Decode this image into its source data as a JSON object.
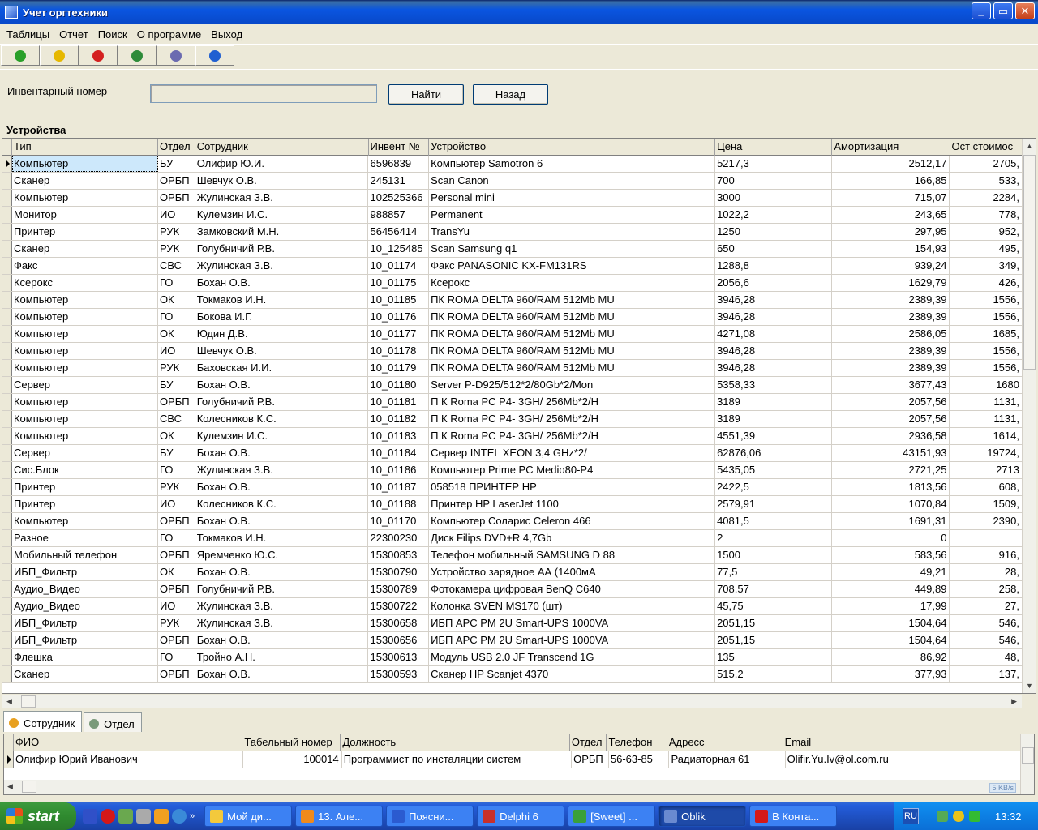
{
  "window": {
    "title": "Учет оргтехники"
  },
  "menu": [
    "Таблицы",
    "Отчет",
    "Поиск",
    "О программе",
    "Выход"
  ],
  "toolbar_icons": [
    {
      "name": "ok-icon",
      "color": "#2aa02a"
    },
    {
      "name": "edit-pencil-icon",
      "color": "#e6b800"
    },
    {
      "name": "delete-icon",
      "color": "#d42020"
    },
    {
      "name": "excel-export-icon",
      "color": "#2e8b3a"
    },
    {
      "name": "tools-icon",
      "color": "#6b6bb0"
    },
    {
      "name": "info-icon",
      "color": "#1f5fd1"
    }
  ],
  "search": {
    "label": "Инвентарный номер",
    "value": "",
    "find_label": "Найти",
    "back_label": "Назад"
  },
  "devices": {
    "title": "Устройства",
    "columns": [
      "Тип",
      "Отдел",
      "Сотрудник",
      "Инвент №",
      "Устройство",
      "Цена",
      "Амортизация",
      "Ост стоимос"
    ],
    "rows": [
      [
        "Компьютер",
        "БУ",
        "Олифир Ю.И.",
        "6596839",
        "Компьютер Samotron 6",
        "5217,3",
        "2512,17",
        "2705,"
      ],
      [
        "Сканер",
        "ОРБП",
        "Шевчук О.В.",
        "245131",
        "Scan Canon",
        "700",
        "166,85",
        "533,"
      ],
      [
        "Компьютер",
        "ОРБП",
        "Жулинская З.В.",
        "102525366",
        "Personal mini",
        "3000",
        "715,07",
        "2284,"
      ],
      [
        "Монитор",
        "ИО",
        "Кулемзин И.С.",
        "988857",
        "Permanent",
        "1022,2",
        "243,65",
        "778,"
      ],
      [
        "Принтер",
        "РУК",
        "Замковский М.Н.",
        "56456414",
        "TransYu",
        "1250",
        "297,95",
        "952,"
      ],
      [
        "Сканер",
        "РУК",
        "Голубничий Р.В.",
        "10_125485",
        "Scan Samsung q1",
        "650",
        "154,93",
        "495,"
      ],
      [
        "Факс",
        "СВС",
        "Жулинская З.В.",
        "10_01174",
        "Факс PANASONIC KX-FM131RS",
        "1288,8",
        "939,24",
        "349,"
      ],
      [
        "Ксерокс",
        "ГО",
        "Бохан О.В.",
        "10_01175",
        "Ксерокс",
        "2056,6",
        "1629,79",
        "426,"
      ],
      [
        "Компьютер",
        "ОК",
        "Токмаков И.Н.",
        "10_01185",
        "ПК ROMA DELTA 960/RAM 512Mb MU",
        "3946,28",
        "2389,39",
        "1556,"
      ],
      [
        "Компьютер",
        "ГО",
        "Бокова И.Г.",
        "10_01176",
        "ПК ROMA DELTA 960/RAM 512Mb MU",
        "3946,28",
        "2389,39",
        "1556,"
      ],
      [
        "Компьютер",
        "ОК",
        "Юдин Д.В.",
        "10_01177",
        "ПК ROMA DELTA 960/RAM 512Mb MU",
        "4271,08",
        "2586,05",
        "1685,"
      ],
      [
        "Компьютер",
        "ИО",
        "Шевчук О.В.",
        "10_01178",
        "ПК ROMA DELTA 960/RAM 512Mb MU",
        "3946,28",
        "2389,39",
        "1556,"
      ],
      [
        "Компьютер",
        "РУК",
        "Баховская И.И.",
        "10_01179",
        "ПК ROMA DELTA 960/RAM 512Mb MU",
        "3946,28",
        "2389,39",
        "1556,"
      ],
      [
        "Сервер",
        "БУ",
        "Бохан О.В.",
        "10_01180",
        "Server P-D925/512*2/80Gb*2/Mon",
        "5358,33",
        "3677,43",
        "1680"
      ],
      [
        "Компьютер",
        "ОРБП",
        "Голубничий Р.В.",
        "10_01181",
        "П К Roma PC P4- 3GH/ 256Mb*2/H",
        "3189",
        "2057,56",
        "1131,"
      ],
      [
        "Компьютер",
        "СВС",
        "Колесников К.С.",
        "10_01182",
        "П К Roma PC P4- 3GH/ 256Mb*2/H",
        "3189",
        "2057,56",
        "1131,"
      ],
      [
        "Компьютер",
        "ОК",
        "Кулемзин И.С.",
        "10_01183",
        "П К Roma PC P4- 3GH/ 256Mb*2/H",
        "4551,39",
        "2936,58",
        "1614,"
      ],
      [
        "Сервер",
        "БУ",
        "Бохан О.В.",
        "10_01184",
        "Сервер  INTEL XEON 3,4 GHz*2/",
        "62876,06",
        "43151,93",
        "19724,"
      ],
      [
        "Сис.Блок",
        "ГО",
        "Жулинская З.В.",
        "10_01186",
        "Компьютер Prime PC Medio80-P4",
        "5435,05",
        "2721,25",
        "2713"
      ],
      [
        "Принтер",
        "РУК",
        "Бохан О.В.",
        "10_01187",
        "058518 ПРИНТЕР HP",
        "2422,5",
        "1813,56",
        "608,"
      ],
      [
        "Принтер",
        "ИО",
        "Колесников К.С.",
        "10_01188",
        "Принтер HP LaserJet 1100",
        "2579,91",
        "1070,84",
        "1509,"
      ],
      [
        "Компьютер",
        "ОРБП",
        "Бохан О.В.",
        "10_01170",
        "Компьютер Соларис Celeron 466",
        "4081,5",
        "1691,31",
        "2390,"
      ],
      [
        "Разное",
        "ГО",
        "Токмаков И.Н.",
        "22300230",
        "Диск Filips DVD+R 4,7Gb",
        "2",
        "0",
        ""
      ],
      [
        "Мобильный телефон",
        "ОРБП",
        "Яремченко Ю.С.",
        "15300853",
        "Телефон мобильный SAMSUNG D 88",
        "1500",
        "583,56",
        "916,"
      ],
      [
        "ИБП_Фильтр",
        "ОК",
        "Бохан О.В.",
        "15300790",
        "Устройство зарядное АА (1400мА",
        "77,5",
        "49,21",
        "28,"
      ],
      [
        "Аудио_Видео",
        "ОРБП",
        "Голубничий Р.В.",
        "15300789",
        "Фотокамера цифровая BenQ C640",
        "708,57",
        "449,89",
        "258,"
      ],
      [
        "Аудио_Видео",
        "ИО",
        "Жулинская З.В.",
        "15300722",
        "Колонка SVEN MS170 (шт)",
        "45,75",
        "17,99",
        "27,"
      ],
      [
        "ИБП_Фильтр",
        "РУК",
        "Жулинская З.В.",
        "15300658",
        "ИБП APC PM 2U Smart-UPS 1000VA",
        "2051,15",
        "1504,64",
        "546,"
      ],
      [
        "ИБП_Фильтр",
        "ОРБП",
        "Бохан О.В.",
        "15300656",
        "ИБП APC PM 2U Smart-UPS 1000VA",
        "2051,15",
        "1504,64",
        "546,"
      ],
      [
        "Флешка",
        "ГО",
        "Тройно А.Н.",
        "15300613",
        "Модуль USB 2.0 JF Transcend 1G",
        "135",
        "86,92",
        "48,"
      ],
      [
        "Сканер",
        "ОРБП",
        "Бохан О.В.",
        "15300593",
        "Сканер HP Scanjet 4370",
        "515,2",
        "377,93",
        "137,"
      ]
    ]
  },
  "tabs": [
    {
      "label": "Сотрудник",
      "icon": "person-icon",
      "active": true
    },
    {
      "label": "Отдел",
      "icon": "department-icon",
      "active": false
    }
  ],
  "employees": {
    "columns": [
      "ФИО",
      "Табельный номер",
      "Должность",
      "Отдел",
      "Телефон",
      "Адресс",
      "Email"
    ],
    "rows": [
      [
        "Олифир Юрий Иванович",
        "100014",
        "Программист по инсталяции систем",
        "ОРБП",
        "56-63-85",
        "Радиаторная 61",
        "Olifir.Yu.Iv@ol.com.ru"
      ]
    ],
    "net_badge": "5 KB/s"
  },
  "taskbar": {
    "start_label": "start",
    "tasks": [
      {
        "label": "Мой ди...",
        "color": "#f3c93c"
      },
      {
        "label": "13. Але...",
        "color": "#f08a1c"
      },
      {
        "label": "Поясни...",
        "color": "#2b5bd0"
      },
      {
        "label": "Delphi 6",
        "color": "#c8302a"
      },
      {
        "label": "[Sweet] ...",
        "color": "#3aa03a"
      },
      {
        "label": "Oblik",
        "color": "#6a8ad0"
      },
      {
        "label": "В Конта...",
        "color": "#d41818"
      }
    ],
    "lang": "RU",
    "clock": "13:32"
  }
}
